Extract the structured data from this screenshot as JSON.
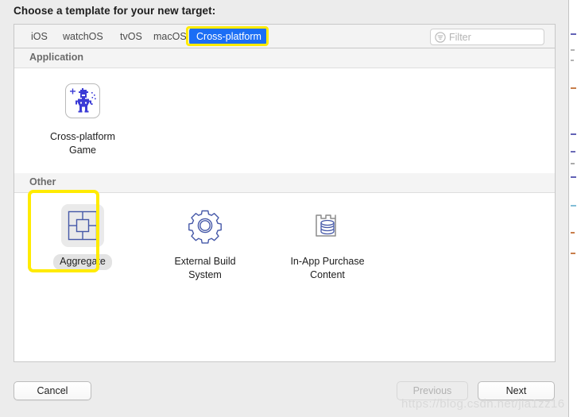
{
  "dialog": {
    "title": "Choose a template for your new target:"
  },
  "tabs": [
    {
      "label": "iOS",
      "selected": false
    },
    {
      "label": "watchOS",
      "selected": false
    },
    {
      "label": "tvOS",
      "selected": false
    },
    {
      "label": "macOS",
      "selected": false
    },
    {
      "label": "Cross-platform",
      "selected": true
    }
  ],
  "filter": {
    "placeholder": "Filter",
    "value": "",
    "icon": "filter-icon"
  },
  "sections": [
    {
      "title": "Application",
      "items": [
        {
          "label": "Cross-platform\nGame",
          "label_line1": "Cross-platform",
          "label_line2": "Game",
          "icon": "pixel-robot-game-icon",
          "selected": false
        }
      ]
    },
    {
      "title": "Other",
      "items": [
        {
          "label": "Aggregate",
          "label_line1": "Aggregate",
          "label_line2": "",
          "icon": "aggregate-squares-icon",
          "selected": true
        },
        {
          "label": "External Build System",
          "label_line1": "External Build",
          "label_line2": "System",
          "icon": "gear-icon",
          "selected": false
        },
        {
          "label": "In-App Purchase Content",
          "label_line1": "In-App Purchase",
          "label_line2": "Content",
          "icon": "purchase-box-icon",
          "selected": false
        }
      ]
    }
  ],
  "footer": {
    "cancel_label": "Cancel",
    "previous_label": "Previous",
    "previous_disabled": true,
    "next_label": "Next",
    "next_disabled": false
  },
  "watermark": {
    "text": "https://blog.csdn.net/jia1zz16"
  },
  "colors": {
    "accent_blue": "#1b6ef5",
    "highlight_yellow": "#ffeb00",
    "icon_blue": "#4558a8",
    "dialog_background": "#ececec",
    "panel_background": "#ffffff",
    "section_header_background": "#f4f4f4"
  }
}
